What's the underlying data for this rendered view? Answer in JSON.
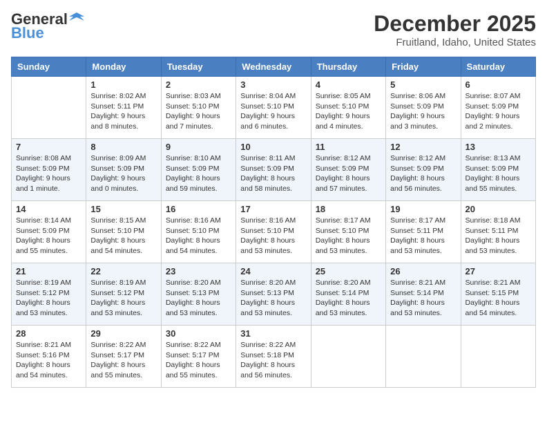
{
  "header": {
    "logo_general": "General",
    "logo_blue": "Blue",
    "month_year": "December 2025",
    "location": "Fruitland, Idaho, United States"
  },
  "weekdays": [
    "Sunday",
    "Monday",
    "Tuesday",
    "Wednesday",
    "Thursday",
    "Friday",
    "Saturday"
  ],
  "weeks": [
    [
      {
        "num": "",
        "sunrise": "",
        "sunset": "",
        "daylight": ""
      },
      {
        "num": "1",
        "sunrise": "Sunrise: 8:02 AM",
        "sunset": "Sunset: 5:11 PM",
        "daylight": "Daylight: 9 hours and 8 minutes."
      },
      {
        "num": "2",
        "sunrise": "Sunrise: 8:03 AM",
        "sunset": "Sunset: 5:10 PM",
        "daylight": "Daylight: 9 hours and 7 minutes."
      },
      {
        "num": "3",
        "sunrise": "Sunrise: 8:04 AM",
        "sunset": "Sunset: 5:10 PM",
        "daylight": "Daylight: 9 hours and 6 minutes."
      },
      {
        "num": "4",
        "sunrise": "Sunrise: 8:05 AM",
        "sunset": "Sunset: 5:10 PM",
        "daylight": "Daylight: 9 hours and 4 minutes."
      },
      {
        "num": "5",
        "sunrise": "Sunrise: 8:06 AM",
        "sunset": "Sunset: 5:09 PM",
        "daylight": "Daylight: 9 hours and 3 minutes."
      },
      {
        "num": "6",
        "sunrise": "Sunrise: 8:07 AM",
        "sunset": "Sunset: 5:09 PM",
        "daylight": "Daylight: 9 hours and 2 minutes."
      }
    ],
    [
      {
        "num": "7",
        "sunrise": "Sunrise: 8:08 AM",
        "sunset": "Sunset: 5:09 PM",
        "daylight": "Daylight: 9 hours and 1 minute."
      },
      {
        "num": "8",
        "sunrise": "Sunrise: 8:09 AM",
        "sunset": "Sunset: 5:09 PM",
        "daylight": "Daylight: 9 hours and 0 minutes."
      },
      {
        "num": "9",
        "sunrise": "Sunrise: 8:10 AM",
        "sunset": "Sunset: 5:09 PM",
        "daylight": "Daylight: 8 hours and 59 minutes."
      },
      {
        "num": "10",
        "sunrise": "Sunrise: 8:11 AM",
        "sunset": "Sunset: 5:09 PM",
        "daylight": "Daylight: 8 hours and 58 minutes."
      },
      {
        "num": "11",
        "sunrise": "Sunrise: 8:12 AM",
        "sunset": "Sunset: 5:09 PM",
        "daylight": "Daylight: 8 hours and 57 minutes."
      },
      {
        "num": "12",
        "sunrise": "Sunrise: 8:12 AM",
        "sunset": "Sunset: 5:09 PM",
        "daylight": "Daylight: 8 hours and 56 minutes."
      },
      {
        "num": "13",
        "sunrise": "Sunrise: 8:13 AM",
        "sunset": "Sunset: 5:09 PM",
        "daylight": "Daylight: 8 hours and 55 minutes."
      }
    ],
    [
      {
        "num": "14",
        "sunrise": "Sunrise: 8:14 AM",
        "sunset": "Sunset: 5:09 PM",
        "daylight": "Daylight: 8 hours and 55 minutes."
      },
      {
        "num": "15",
        "sunrise": "Sunrise: 8:15 AM",
        "sunset": "Sunset: 5:10 PM",
        "daylight": "Daylight: 8 hours and 54 minutes."
      },
      {
        "num": "16",
        "sunrise": "Sunrise: 8:16 AM",
        "sunset": "Sunset: 5:10 PM",
        "daylight": "Daylight: 8 hours and 54 minutes."
      },
      {
        "num": "17",
        "sunrise": "Sunrise: 8:16 AM",
        "sunset": "Sunset: 5:10 PM",
        "daylight": "Daylight: 8 hours and 53 minutes."
      },
      {
        "num": "18",
        "sunrise": "Sunrise: 8:17 AM",
        "sunset": "Sunset: 5:10 PM",
        "daylight": "Daylight: 8 hours and 53 minutes."
      },
      {
        "num": "19",
        "sunrise": "Sunrise: 8:17 AM",
        "sunset": "Sunset: 5:11 PM",
        "daylight": "Daylight: 8 hours and 53 minutes."
      },
      {
        "num": "20",
        "sunrise": "Sunrise: 8:18 AM",
        "sunset": "Sunset: 5:11 PM",
        "daylight": "Daylight: 8 hours and 53 minutes."
      }
    ],
    [
      {
        "num": "21",
        "sunrise": "Sunrise: 8:19 AM",
        "sunset": "Sunset: 5:12 PM",
        "daylight": "Daylight: 8 hours and 53 minutes."
      },
      {
        "num": "22",
        "sunrise": "Sunrise: 8:19 AM",
        "sunset": "Sunset: 5:12 PM",
        "daylight": "Daylight: 8 hours and 53 minutes."
      },
      {
        "num": "23",
        "sunrise": "Sunrise: 8:20 AM",
        "sunset": "Sunset: 5:13 PM",
        "daylight": "Daylight: 8 hours and 53 minutes."
      },
      {
        "num": "24",
        "sunrise": "Sunrise: 8:20 AM",
        "sunset": "Sunset: 5:13 PM",
        "daylight": "Daylight: 8 hours and 53 minutes."
      },
      {
        "num": "25",
        "sunrise": "Sunrise: 8:20 AM",
        "sunset": "Sunset: 5:14 PM",
        "daylight": "Daylight: 8 hours and 53 minutes."
      },
      {
        "num": "26",
        "sunrise": "Sunrise: 8:21 AM",
        "sunset": "Sunset: 5:14 PM",
        "daylight": "Daylight: 8 hours and 53 minutes."
      },
      {
        "num": "27",
        "sunrise": "Sunrise: 8:21 AM",
        "sunset": "Sunset: 5:15 PM",
        "daylight": "Daylight: 8 hours and 54 minutes."
      }
    ],
    [
      {
        "num": "28",
        "sunrise": "Sunrise: 8:21 AM",
        "sunset": "Sunset: 5:16 PM",
        "daylight": "Daylight: 8 hours and 54 minutes."
      },
      {
        "num": "29",
        "sunrise": "Sunrise: 8:22 AM",
        "sunset": "Sunset: 5:17 PM",
        "daylight": "Daylight: 8 hours and 55 minutes."
      },
      {
        "num": "30",
        "sunrise": "Sunrise: 8:22 AM",
        "sunset": "Sunset: 5:17 PM",
        "daylight": "Daylight: 8 hours and 55 minutes."
      },
      {
        "num": "31",
        "sunrise": "Sunrise: 8:22 AM",
        "sunset": "Sunset: 5:18 PM",
        "daylight": "Daylight: 8 hours and 56 minutes."
      },
      {
        "num": "",
        "sunrise": "",
        "sunset": "",
        "daylight": ""
      },
      {
        "num": "",
        "sunrise": "",
        "sunset": "",
        "daylight": ""
      },
      {
        "num": "",
        "sunrise": "",
        "sunset": "",
        "daylight": ""
      }
    ]
  ]
}
